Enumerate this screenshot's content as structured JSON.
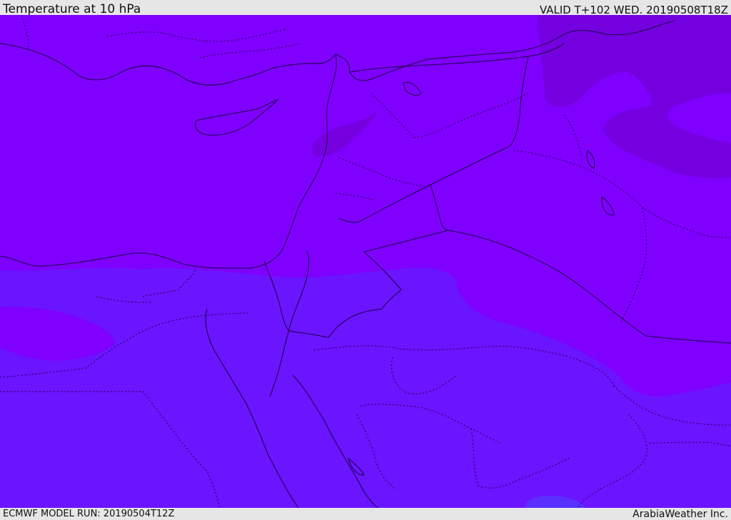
{
  "header": {
    "title": "Temperature at 10 hPa",
    "valid": "VALID T+102 WED. 20190508T18Z"
  },
  "footer": {
    "model_run": "ECMWF MODEL RUN: 20190504T12Z",
    "brand": "ArabiaWeather Inc."
  },
  "map": {
    "fill_colors": {
      "north_band": "#7f00ff",
      "south_band": "#6a14ff",
      "warm_patch": "#7400e0",
      "cool_patch": "#5a30ff"
    },
    "line_color": "#1a0040"
  }
}
